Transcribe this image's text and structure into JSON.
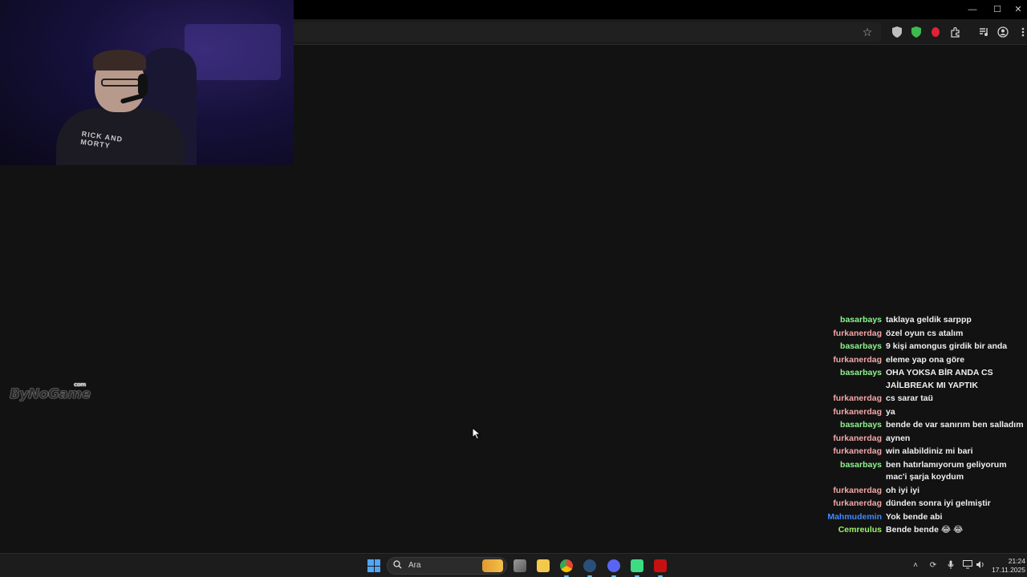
{
  "window": {
    "controls": {
      "minimize": "—",
      "maximize": "☐",
      "close": "✕"
    }
  },
  "browser": {
    "toolbar_icons": [
      "star-icon",
      "shield-icon",
      "vpn-icon",
      "record-icon",
      "extensions-icon",
      "media-icon",
      "profile-icon",
      "menu-icon"
    ]
  },
  "overlay": {
    "logo_text": "ByNoGame",
    "logo_sup": "com"
  },
  "chat": {
    "messages": [
      {
        "user": "basarbays",
        "color": "#8ef58e",
        "text": "taklaya geldik sarppp"
      },
      {
        "user": "furkanerdag",
        "color": "#f4a6a6",
        "text": "özel oyun cs atalım"
      },
      {
        "user": "basarbays",
        "color": "#8ef58e",
        "text": "9 kişi amongus girdik bir anda"
      },
      {
        "user": "furkanerdag",
        "color": "#f4a6a6",
        "text": "eleme yap ona göre"
      },
      {
        "user": "basarbays",
        "color": "#8ef58e",
        "text": "OHA YOKSA BİR ANDA CS JAİLBREAK MI YAPTIK"
      },
      {
        "user": "furkanerdag",
        "color": "#f4a6a6",
        "text": "cs sarar taü"
      },
      {
        "user": "furkanerdag",
        "color": "#f4a6a6",
        "text": "ya"
      },
      {
        "user": "basarbays",
        "color": "#8ef58e",
        "text": "bende de var sanırım ben salladım"
      },
      {
        "user": "furkanerdag",
        "color": "#f4a6a6",
        "text": "aynen"
      },
      {
        "user": "furkanerdag",
        "color": "#f4a6a6",
        "text": "win alabildiniz mi bari"
      },
      {
        "user": "basarbays",
        "color": "#8ef58e",
        "text": "ben hatırlamıyorum geliyorum mac'i şarja koydum"
      },
      {
        "user": "furkanerdag",
        "color": "#f4a6a6",
        "text": "oh iyi iyi"
      },
      {
        "user": "furkanerdag",
        "color": "#f4a6a6",
        "text": "dünden sonra iyi gelmiştir"
      },
      {
        "user": "Mahmudemin",
        "color": "#3d8bff",
        "text": "Yok bende abi"
      },
      {
        "user": "Cemreulus",
        "color": "#9df56b",
        "text": "Bende bende 😂 😂"
      }
    ]
  },
  "taskbar": {
    "search_placeholder": "Ara",
    "apps": [
      "task-view",
      "file-explorer",
      "chrome",
      "steam",
      "discord",
      "android-app",
      "among-us"
    ],
    "time": "21:24",
    "date": "17.11.2025"
  }
}
